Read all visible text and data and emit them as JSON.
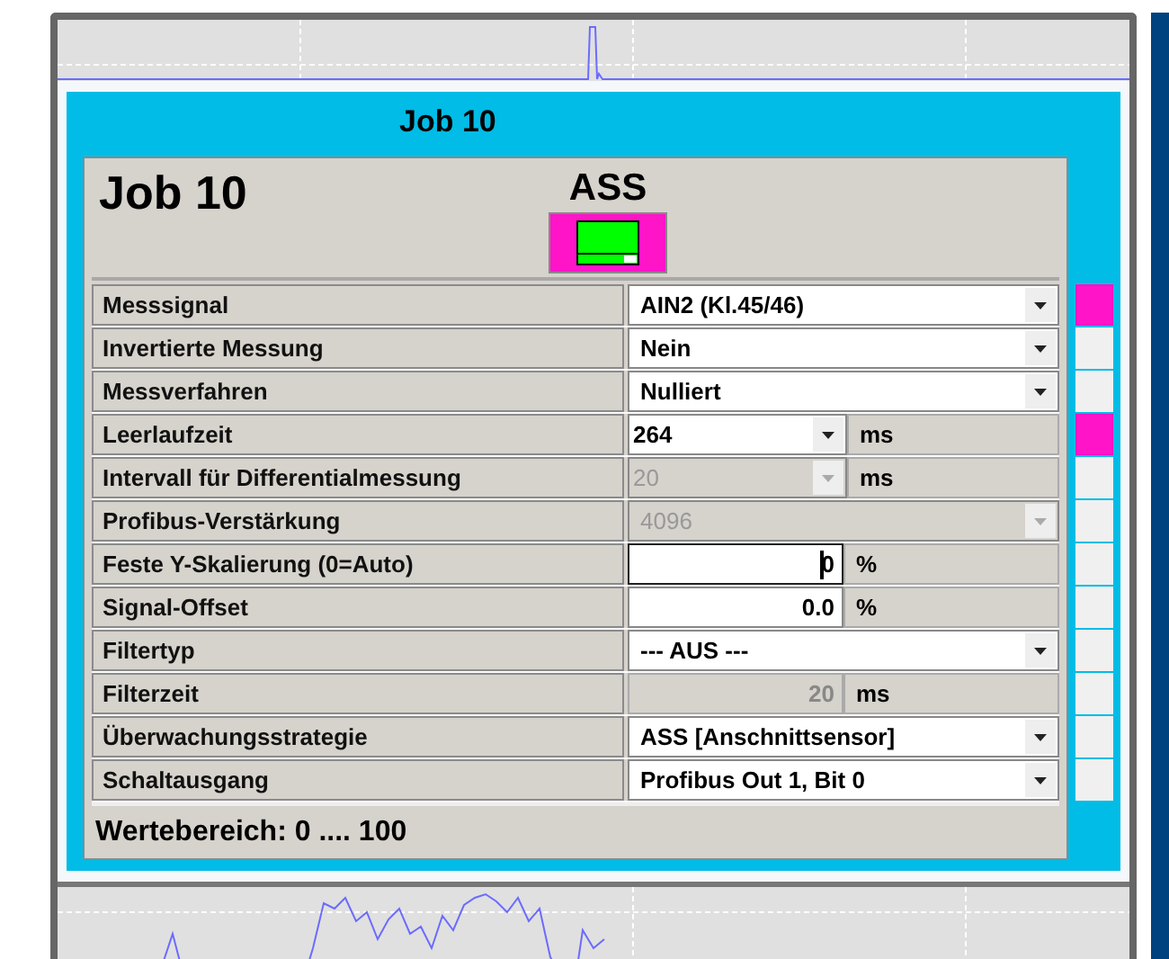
{
  "panel_title": "Job 10",
  "job": {
    "name": "Job 10",
    "mode": "ASS"
  },
  "rows": [
    {
      "label": "Messsignal",
      "kind": "dropdown",
      "value": "AIN2 (Kl.45/46)",
      "disabled": false,
      "flagged": true
    },
    {
      "label": "Invertierte Messung",
      "kind": "dropdown",
      "value": "Nein",
      "disabled": false,
      "flagged": false
    },
    {
      "label": "Messverfahren",
      "kind": "dropdown",
      "value": "Nulliert",
      "disabled": false,
      "flagged": false
    },
    {
      "label": "Leerlaufzeit",
      "kind": "combo",
      "value": "264",
      "unit": "ms",
      "disabled": false,
      "flagged": true
    },
    {
      "label": "Intervall für Differentialmessung",
      "kind": "combo",
      "value": "20",
      "unit": "ms",
      "disabled": true,
      "flagged": false
    },
    {
      "label": "Profibus-Verstärkung",
      "kind": "dropdown",
      "value": "4096",
      "disabled": true,
      "flagged": false
    },
    {
      "label": "Feste Y-Skalierung (0=Auto)",
      "kind": "input",
      "value": "0",
      "unit": "%",
      "focused": true,
      "flagged": false
    },
    {
      "label": "Signal-Offset",
      "kind": "input",
      "value": "0.0",
      "unit": "%",
      "focused": false,
      "flagged": false
    },
    {
      "label": "Filtertyp",
      "kind": "dropdown",
      "value": "--- AUS ---",
      "disabled": false,
      "flagged": false
    },
    {
      "label": "Filterzeit",
      "kind": "readonly",
      "value": "20",
      "unit": "ms",
      "flagged": false
    },
    {
      "label": "Überwachungsstrategie",
      "kind": "dropdown",
      "value": "ASS [Anschnittsensor]",
      "disabled": false,
      "flagged": false
    },
    {
      "label": "Schaltausgang",
      "kind": "dropdown",
      "value": "Profibus Out 1, Bit 0",
      "disabled": false,
      "flagged": false
    }
  ],
  "value_range": "Wertebereich: 0 .... 100"
}
